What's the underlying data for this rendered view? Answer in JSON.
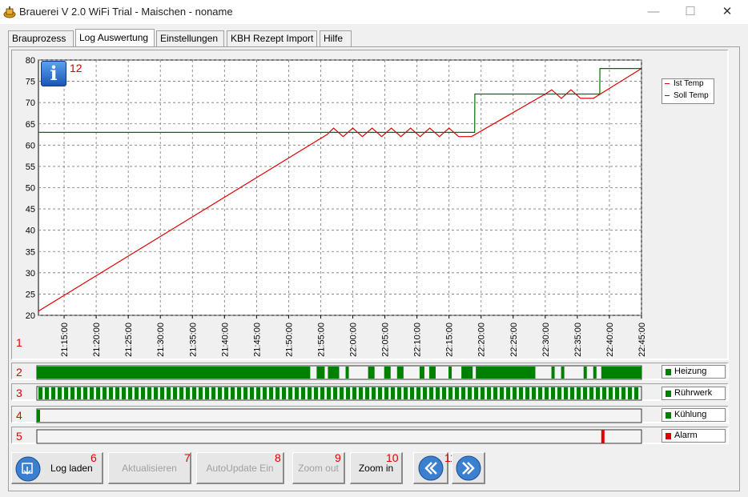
{
  "window": {
    "title": "Brauerei V 2.0 WiFi Trial - Maischen - noname",
    "minimize_icon": "minimize-icon",
    "maximize_icon": "maximize-icon",
    "close_icon": "close-icon"
  },
  "tabs": [
    {
      "label": "Brauprozess",
      "active": false
    },
    {
      "label": "Log Auswertung",
      "active": true
    },
    {
      "label": "Einstellungen",
      "active": false
    },
    {
      "label": "KBH Rezept Import",
      "active": false
    },
    {
      "label": "Hilfe",
      "active": false
    }
  ],
  "markers": {
    "m1": "1",
    "m2": "2",
    "m3": "3",
    "m4": "4",
    "m5": "5",
    "m6": "6",
    "m7": "7",
    "m8": "8",
    "m9": "9",
    "m10": "10",
    "m11": "11",
    "m12": "12"
  },
  "info_button": {
    "glyph": "i",
    "icon": "info-icon"
  },
  "chart_data": {
    "type": "line",
    "title": "",
    "xlabel": "",
    "ylabel": "",
    "ylim": [
      20,
      80
    ],
    "yticks": [
      20,
      25,
      30,
      35,
      40,
      45,
      50,
      55,
      60,
      65,
      70,
      75,
      80
    ],
    "xlim_minutes": [
      "21:11:00",
      "22:45:00"
    ],
    "xticks": [
      "21:15:00",
      "21:20:00",
      "21:25:00",
      "21:30:00",
      "21:35:00",
      "21:40:00",
      "21:45:00",
      "21:50:00",
      "21:55:00",
      "22:00:00",
      "22:05:00",
      "22:10:00",
      "22:15:00",
      "22:20:00",
      "22:25:00",
      "22:30:00",
      "22:35:00",
      "22:40:00",
      "22:45:00"
    ],
    "grid": true,
    "legend_position": "top-right",
    "series": [
      {
        "name": "Ist Temp",
        "color": "#e00000",
        "x": [
          "21:11:00",
          "21:56:00",
          "21:57:00",
          "21:58:30",
          "22:00:00",
          "22:01:30",
          "22:03:00",
          "22:04:30",
          "22:06:00",
          "22:07:30",
          "22:09:00",
          "22:10:30",
          "22:12:00",
          "22:13:30",
          "22:15:00",
          "22:16:30",
          "22:18:30",
          "22:30:00",
          "22:31:00",
          "22:32:30",
          "22:34:00",
          "22:35:30",
          "22:37:30",
          "22:45:00"
        ],
        "values": [
          21,
          62.5,
          64,
          62,
          64,
          62,
          64,
          62,
          64,
          62,
          64,
          62,
          64,
          62,
          64,
          62,
          62,
          72,
          73,
          71,
          73,
          71,
          71,
          78
        ]
      },
      {
        "name": "Soll Temp",
        "color": "#007000",
        "x": [
          "21:11:00",
          "22:18:30",
          "22:19:00",
          "22:19:01",
          "22:38:30",
          "22:38:31",
          "22:45:00"
        ],
        "values": [
          63,
          63,
          63,
          72,
          72,
          78,
          78
        ]
      }
    ]
  },
  "status_rows": [
    {
      "label": "Heizung",
      "color": "#008000",
      "segments": [
        [
          "21:11:00",
          "21:53:30"
        ],
        [
          "21:54:30",
          "21:55:45"
        ],
        [
          "21:56:15",
          "21:58:00"
        ],
        [
          "21:59:00",
          "21:59:30"
        ],
        [
          "22:02:30",
          "22:03:30"
        ],
        [
          "22:05:00",
          "22:06:00"
        ],
        [
          "22:07:00",
          "22:08:00"
        ],
        [
          "22:10:30",
          "22:11:15"
        ],
        [
          "22:12:00",
          "22:13:00"
        ],
        [
          "22:15:00",
          "22:15:30"
        ],
        [
          "22:17:00",
          "22:18:45"
        ],
        [
          "22:19:15",
          "22:28:30"
        ],
        [
          "22:31:00",
          "22:31:30"
        ],
        [
          "22:32:30",
          "22:33:00"
        ],
        [
          "22:36:00",
          "22:36:30"
        ],
        [
          "22:37:30",
          "22:38:00"
        ],
        [
          "22:38:45",
          "22:45:00"
        ]
      ]
    },
    {
      "label": "Rührwerk",
      "color": "#008000",
      "pattern": "striped"
    },
    {
      "label": "Kühlung",
      "color": "#008000",
      "segments": [
        [
          "21:11:00",
          "21:11:30"
        ]
      ]
    },
    {
      "label": "Alarm",
      "color": "#e00000",
      "segments": [
        [
          "22:38:45",
          "22:39:15"
        ]
      ]
    }
  ],
  "buttons": {
    "log_laden": {
      "label": "Log laden",
      "icon": "folder-load-icon"
    },
    "aktualisieren": {
      "label": "Aktualisieren"
    },
    "autoupdate": {
      "label": "AutoUpdate Ein"
    },
    "zoom_out": {
      "label": "Zoom out"
    },
    "zoom_in": {
      "label": "Zoom in"
    },
    "scroll_left": {
      "icon": "double-chevron-left-icon"
    },
    "scroll_right": {
      "icon": "double-chevron-right-icon"
    }
  }
}
